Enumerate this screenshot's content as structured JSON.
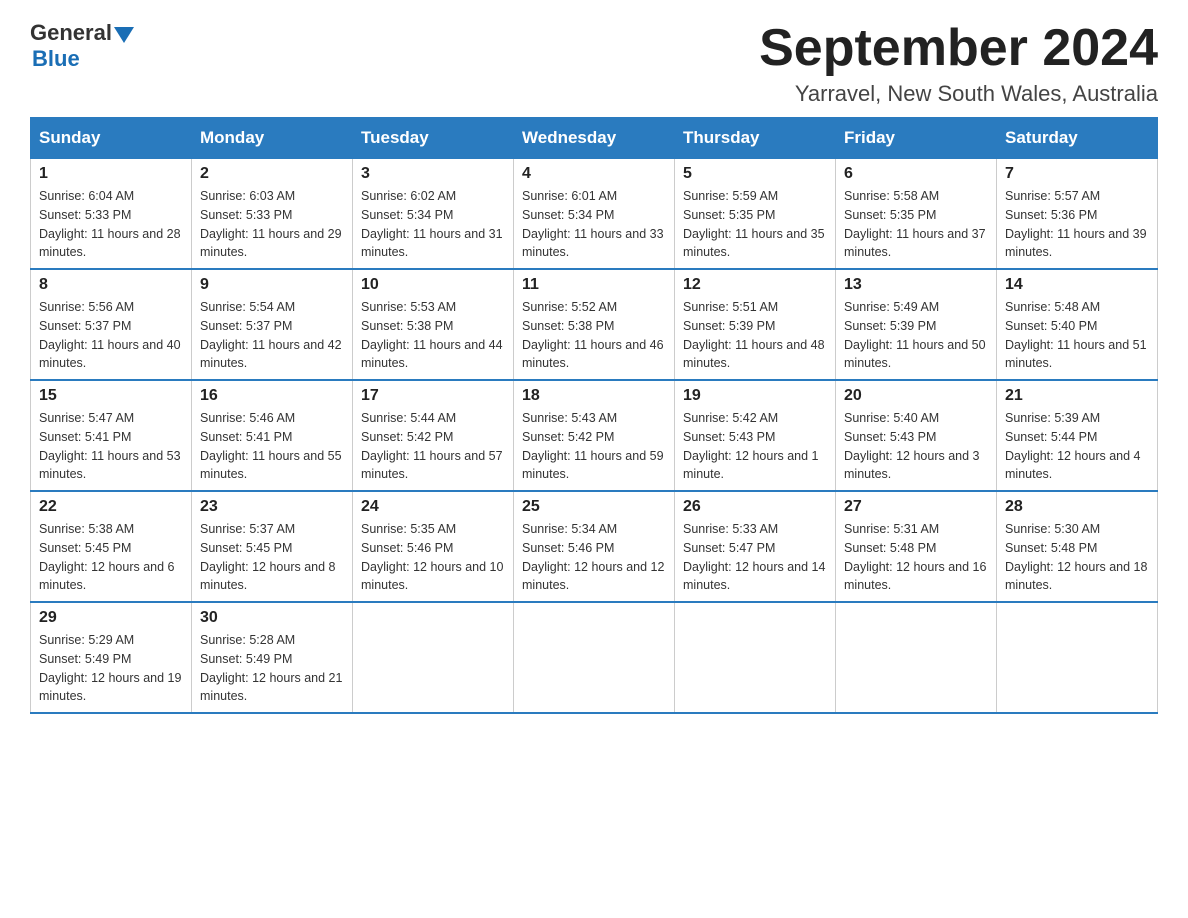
{
  "header": {
    "logo_general": "General",
    "logo_blue": "Blue",
    "month_title": "September 2024",
    "location": "Yarravel, New South Wales, Australia"
  },
  "calendar": {
    "days_of_week": [
      "Sunday",
      "Monday",
      "Tuesday",
      "Wednesday",
      "Thursday",
      "Friday",
      "Saturday"
    ],
    "weeks": [
      [
        {
          "day": "1",
          "sunrise": "6:04 AM",
          "sunset": "5:33 PM",
          "daylight": "11 hours and 28 minutes."
        },
        {
          "day": "2",
          "sunrise": "6:03 AM",
          "sunset": "5:33 PM",
          "daylight": "11 hours and 29 minutes."
        },
        {
          "day": "3",
          "sunrise": "6:02 AM",
          "sunset": "5:34 PM",
          "daylight": "11 hours and 31 minutes."
        },
        {
          "day": "4",
          "sunrise": "6:01 AM",
          "sunset": "5:34 PM",
          "daylight": "11 hours and 33 minutes."
        },
        {
          "day": "5",
          "sunrise": "5:59 AM",
          "sunset": "5:35 PM",
          "daylight": "11 hours and 35 minutes."
        },
        {
          "day": "6",
          "sunrise": "5:58 AM",
          "sunset": "5:35 PM",
          "daylight": "11 hours and 37 minutes."
        },
        {
          "day": "7",
          "sunrise": "5:57 AM",
          "sunset": "5:36 PM",
          "daylight": "11 hours and 39 minutes."
        }
      ],
      [
        {
          "day": "8",
          "sunrise": "5:56 AM",
          "sunset": "5:37 PM",
          "daylight": "11 hours and 40 minutes."
        },
        {
          "day": "9",
          "sunrise": "5:54 AM",
          "sunset": "5:37 PM",
          "daylight": "11 hours and 42 minutes."
        },
        {
          "day": "10",
          "sunrise": "5:53 AM",
          "sunset": "5:38 PM",
          "daylight": "11 hours and 44 minutes."
        },
        {
          "day": "11",
          "sunrise": "5:52 AM",
          "sunset": "5:38 PM",
          "daylight": "11 hours and 46 minutes."
        },
        {
          "day": "12",
          "sunrise": "5:51 AM",
          "sunset": "5:39 PM",
          "daylight": "11 hours and 48 minutes."
        },
        {
          "day": "13",
          "sunrise": "5:49 AM",
          "sunset": "5:39 PM",
          "daylight": "11 hours and 50 minutes."
        },
        {
          "day": "14",
          "sunrise": "5:48 AM",
          "sunset": "5:40 PM",
          "daylight": "11 hours and 51 minutes."
        }
      ],
      [
        {
          "day": "15",
          "sunrise": "5:47 AM",
          "sunset": "5:41 PM",
          "daylight": "11 hours and 53 minutes."
        },
        {
          "day": "16",
          "sunrise": "5:46 AM",
          "sunset": "5:41 PM",
          "daylight": "11 hours and 55 minutes."
        },
        {
          "day": "17",
          "sunrise": "5:44 AM",
          "sunset": "5:42 PM",
          "daylight": "11 hours and 57 minutes."
        },
        {
          "day": "18",
          "sunrise": "5:43 AM",
          "sunset": "5:42 PM",
          "daylight": "11 hours and 59 minutes."
        },
        {
          "day": "19",
          "sunrise": "5:42 AM",
          "sunset": "5:43 PM",
          "daylight": "12 hours and 1 minute."
        },
        {
          "day": "20",
          "sunrise": "5:40 AM",
          "sunset": "5:43 PM",
          "daylight": "12 hours and 3 minutes."
        },
        {
          "day": "21",
          "sunrise": "5:39 AM",
          "sunset": "5:44 PM",
          "daylight": "12 hours and 4 minutes."
        }
      ],
      [
        {
          "day": "22",
          "sunrise": "5:38 AM",
          "sunset": "5:45 PM",
          "daylight": "12 hours and 6 minutes."
        },
        {
          "day": "23",
          "sunrise": "5:37 AM",
          "sunset": "5:45 PM",
          "daylight": "12 hours and 8 minutes."
        },
        {
          "day": "24",
          "sunrise": "5:35 AM",
          "sunset": "5:46 PM",
          "daylight": "12 hours and 10 minutes."
        },
        {
          "day": "25",
          "sunrise": "5:34 AM",
          "sunset": "5:46 PM",
          "daylight": "12 hours and 12 minutes."
        },
        {
          "day": "26",
          "sunrise": "5:33 AM",
          "sunset": "5:47 PM",
          "daylight": "12 hours and 14 minutes."
        },
        {
          "day": "27",
          "sunrise": "5:31 AM",
          "sunset": "5:48 PM",
          "daylight": "12 hours and 16 minutes."
        },
        {
          "day": "28",
          "sunrise": "5:30 AM",
          "sunset": "5:48 PM",
          "daylight": "12 hours and 18 minutes."
        }
      ],
      [
        {
          "day": "29",
          "sunrise": "5:29 AM",
          "sunset": "5:49 PM",
          "daylight": "12 hours and 19 minutes."
        },
        {
          "day": "30",
          "sunrise": "5:28 AM",
          "sunset": "5:49 PM",
          "daylight": "12 hours and 21 minutes."
        },
        null,
        null,
        null,
        null,
        null
      ]
    ]
  }
}
